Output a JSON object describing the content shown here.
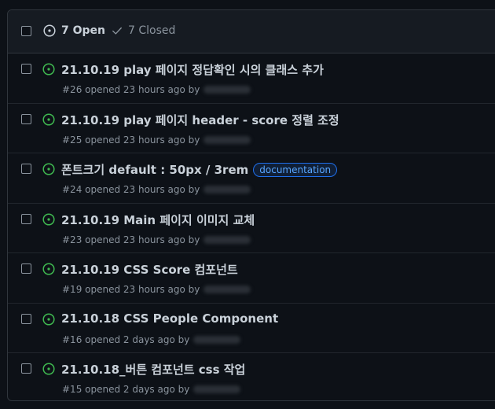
{
  "header": {
    "open_label": "7 Open",
    "closed_label": "7 Closed",
    "open_icon": "issue-opened-icon",
    "closed_icon": "check-icon"
  },
  "colors": {
    "open_green": "#3fb950",
    "label_blue": "#58a6ff"
  },
  "issues": [
    {
      "title": "21.10.19 play 페이지 정답확인 시의 클래스 추가",
      "meta": "#26 opened 23 hours ago by",
      "label": ""
    },
    {
      "title": "21.10.19 play 페이지 header - score 정렬 조정",
      "meta": "#25 opened 23 hours ago by",
      "label": ""
    },
    {
      "title": "폰트크기 default : 50px / 3rem",
      "meta": "#24 opened 23 hours ago by",
      "label": "documentation"
    },
    {
      "title": "21.10.19 Main 페이지 이미지 교체",
      "meta": "#23 opened 23 hours ago by",
      "label": ""
    },
    {
      "title": "21.10.19 CSS Score 컴포넌트",
      "meta": "#19 opened 23 hours ago by",
      "label": ""
    },
    {
      "title": "21.10.18 CSS People Component",
      "meta": "#16 opened 2 days ago by",
      "label": ""
    },
    {
      "title": "21.10.18_버튼 컴포넌트 css 작업",
      "meta": "#15 opened 2 days ago by",
      "label": ""
    }
  ]
}
